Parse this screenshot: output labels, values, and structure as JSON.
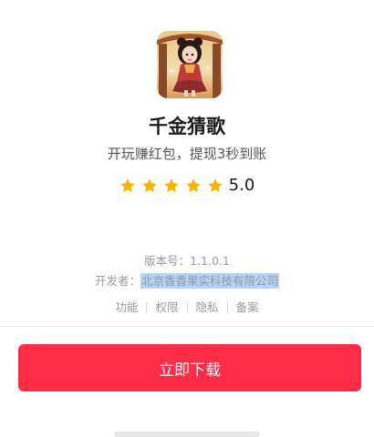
{
  "app": {
    "icon": "app-icon-girl-illustration",
    "name": "千金猜歌",
    "slogan": "开玩赚红包，提现3秒到账"
  },
  "rating": {
    "stars": 5,
    "max_stars": 5,
    "star_icon": "star-icon",
    "star_color": "#f7b500",
    "score": "5.0"
  },
  "meta": {
    "version": "版本号：1.1.0.1",
    "developer_label": "开发者：",
    "developer_name": "北京香香果实科技有限公司"
  },
  "links": [
    {
      "label": "功能"
    },
    {
      "label": "权限"
    },
    {
      "label": "隐私"
    },
    {
      "label": "备案"
    }
  ],
  "download_button": {
    "label": "立即下载",
    "color": "#fe2c46"
  }
}
